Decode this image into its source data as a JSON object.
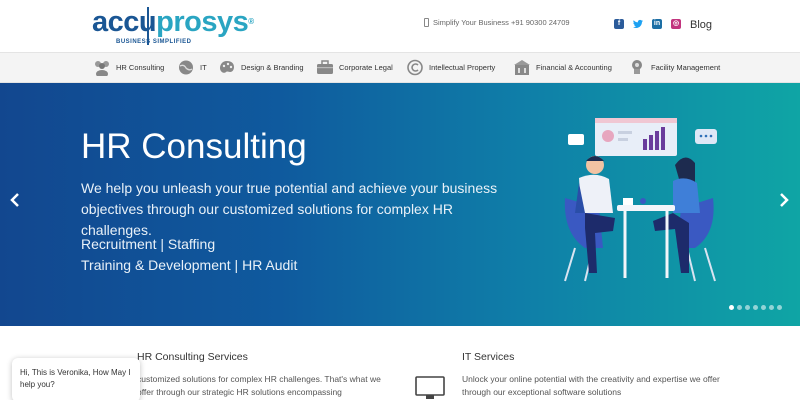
{
  "header": {
    "logo": {
      "part1": "accu",
      "part2": "prosys",
      "tagline": "BUSINESS SIMPLIFIED"
    },
    "contact_text": "Simplify Your Business +91 90300 24709",
    "socials": [
      {
        "icon": "facebook-icon",
        "glyph": "f"
      },
      {
        "icon": "twitter-icon",
        "glyph": "🐦"
      },
      {
        "icon": "linkedin-icon",
        "glyph": "in"
      },
      {
        "icon": "instagram-icon",
        "glyph": "◎"
      }
    ],
    "blog_label": "Blog"
  },
  "nav": {
    "items": [
      {
        "label": "HR Consulting",
        "icon": "people-icon"
      },
      {
        "label": "IT",
        "icon": "globe-icon"
      },
      {
        "label": "Design & Branding",
        "icon": "palette-icon"
      },
      {
        "label": "Corporate Legal",
        "icon": "briefcase-icon"
      },
      {
        "label": "Intellectual Property",
        "icon": "copyright-icon"
      },
      {
        "label": "Financial & Accounting",
        "icon": "finance-icon"
      },
      {
        "label": "Facility Management",
        "icon": "facility-icon"
      }
    ]
  },
  "hero": {
    "title": "HR Consulting",
    "subtitle": "We help you unleash your true potential and achieve your business objectives through our customized solutions for complex HR challenges.",
    "line1": "Recruitment | Staffing",
    "line2": "Training & Development | HR Audit",
    "slide_count": 7,
    "active_slide": 1,
    "colors": {
      "start": "#12478f",
      "end": "#0fa5a5"
    }
  },
  "services": {
    "hr": {
      "title": "HR Consulting Services",
      "desc": "customized solutions for complex HR challenges. That's what we offer through our strategic HR solutions encompassing"
    },
    "it": {
      "title": "IT Services",
      "desc": "Unlock your online potential with the creativity and expertise we offer through our exceptional software solutions"
    }
  },
  "chat": {
    "message": "Hi, This is Veronika, How May I help you?"
  }
}
